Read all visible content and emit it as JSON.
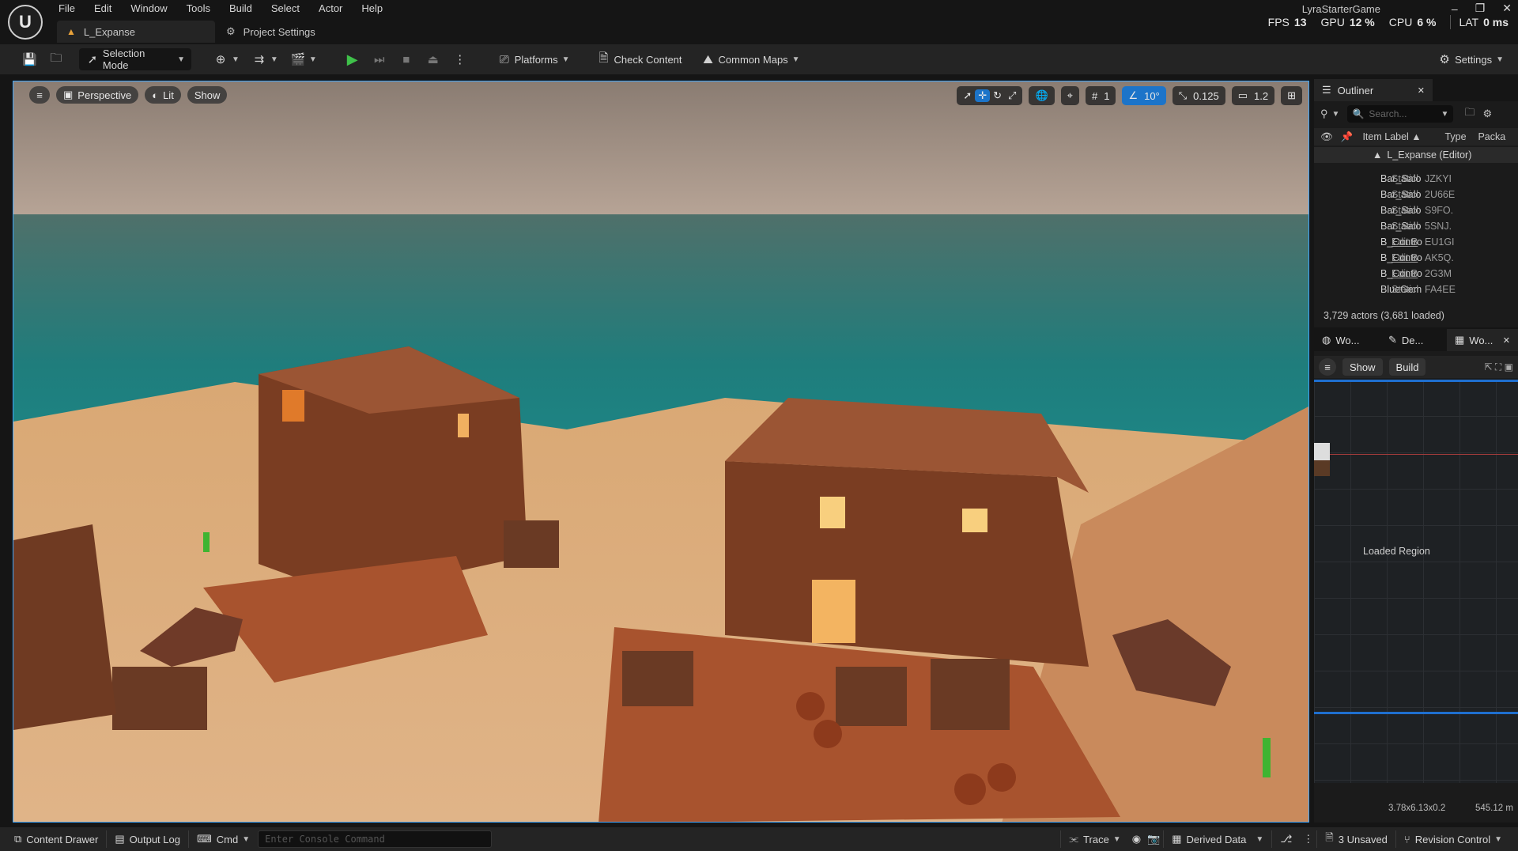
{
  "menu": [
    "File",
    "Edit",
    "Window",
    "Tools",
    "Build",
    "Select",
    "Actor",
    "Help"
  ],
  "doc_tab": {
    "label": "L_Expanse"
  },
  "project_settings_tab": {
    "label": "Project Settings"
  },
  "project_name": "LyraStarterGame",
  "stats": {
    "fps_label": "FPS",
    "fps": "13",
    "gpu_label": "GPU",
    "gpu": "12 %",
    "cpu_label": "CPU",
    "cpu": "6 %",
    "lat_label": "LAT",
    "lat": "0 ms"
  },
  "toolbar": {
    "selection_mode": "Selection Mode",
    "platforms": "Platforms",
    "check_content": "Check Content",
    "common_maps": "Common Maps",
    "settings": "Settings"
  },
  "viewport": {
    "perspective": "Perspective",
    "lit": "Lit",
    "show": "Show",
    "grid_snap": "1",
    "angle_snap": "10°",
    "scale_snap": "0.125",
    "camera_speed": "1.2"
  },
  "outliner": {
    "title": "Outliner",
    "search_placeholder": "Search...",
    "col_label": "Item Label",
    "col_type": "Type",
    "col_package": "Packa",
    "root": "L_Expanse (Editor)",
    "rows": [
      {
        "label": "Bar_Salo",
        "type": "Staticl",
        "pkg": "JZKYI",
        "link": false
      },
      {
        "label": "Bar_Salo",
        "type": "Staticl",
        "pkg": "2U66E",
        "link": false
      },
      {
        "label": "Bar_Salo",
        "type": "Staticl",
        "pkg": "S9FO.",
        "link": false
      },
      {
        "label": "Bar_Salo",
        "type": "Staticl",
        "pkg": "5SNJ.",
        "link": false
      },
      {
        "label": "B_Contro",
        "type": "Edit B",
        "pkg": "EU1GI",
        "link": true
      },
      {
        "label": "B_Contro",
        "type": "Edit B",
        "pkg": "AK5Q.",
        "link": true
      },
      {
        "label": "B_Contro",
        "type": "Edit B",
        "pkg": "2G3M",
        "link": true
      },
      {
        "label": "BlueGem",
        "type": "Staticl",
        "pkg": "FA4EE",
        "link": false
      }
    ],
    "actor_count": "3,729 actors (3,681 loaded)"
  },
  "world_partition": {
    "tabs": [
      "Wo...",
      "De...",
      "Wo..."
    ],
    "show": "Show",
    "build": "Build",
    "loaded_region": "Loaded Region",
    "coords": "3.78x6.13x0.2",
    "distance": "545.12 m"
  },
  "statusbar": {
    "content_drawer": "Content Drawer",
    "output_log": "Output Log",
    "cmd": "Cmd",
    "console_placeholder": "Enter Console Command",
    "trace": "Trace",
    "derived_data": "Derived Data",
    "unsaved": "3 Unsaved",
    "revision_control": "Revision Control"
  }
}
